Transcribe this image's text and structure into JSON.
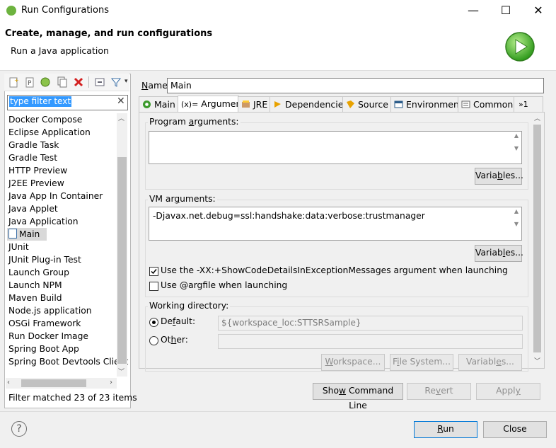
{
  "window": {
    "title": "Run Configurations",
    "minimize": "—",
    "maximize": "☐",
    "close": "✕"
  },
  "header": {
    "title": "Create, manage, and run configurations",
    "subtitle": "Run a Java application"
  },
  "left": {
    "filter_placeholder": "type filter text",
    "items": [
      "Docker Compose",
      "Eclipse Application",
      "Gradle Task",
      "Gradle Test",
      "HTTP Preview",
      "J2EE Preview",
      "Java App In Container",
      "Java Applet",
      "Java Application",
      "Main",
      "JUnit",
      "JUnit Plug-in Test",
      "Launch Group",
      "Launch NPM",
      "Maven Build",
      "Node.js application",
      "OSGi Framework",
      "Run Docker Image",
      "Spring Boot App",
      "Spring Boot Devtools Client"
    ],
    "selected": "Main",
    "status": "Filter matched 23 of 23 items"
  },
  "name": {
    "label": "Name:",
    "value": "Main"
  },
  "tabs": [
    "Main",
    "Arguments",
    "JRE",
    "Dependencies",
    "Source",
    "Environment",
    "Common",
    "»1"
  ],
  "active_tab": "Arguments",
  "arguments": {
    "program_label": "Program arguments:",
    "program_value": "",
    "variables_btn": "Variables...",
    "vm_label": "VM arguments:",
    "vm_value": "-Djavax.net.debug=ssl:handshake:data:verbose:trustmanager",
    "vm_variables_btn": "Variables...",
    "chk_showcode": "Use the -XX:+ShowCodeDetailsInExceptionMessages argument when launching",
    "chk_showcode_checked": true,
    "chk_argfile": "Use @argfile when launching",
    "chk_argfile_checked": false,
    "wd_label": "Working directory:",
    "wd_default_label": "Default:",
    "wd_default_value": "${workspace_loc:STTSRSample}",
    "wd_other_label": "Other:",
    "wd_other_value": "",
    "wd_workspace_btn": "Workspace...",
    "wd_filesystem_btn": "File System...",
    "wd_variables_btn": "Variables..."
  },
  "buttons": {
    "show_cmd": "Show Command Line",
    "revert": "Revert",
    "apply": "Apply",
    "run": "Run",
    "close": "Close",
    "help": "?"
  }
}
